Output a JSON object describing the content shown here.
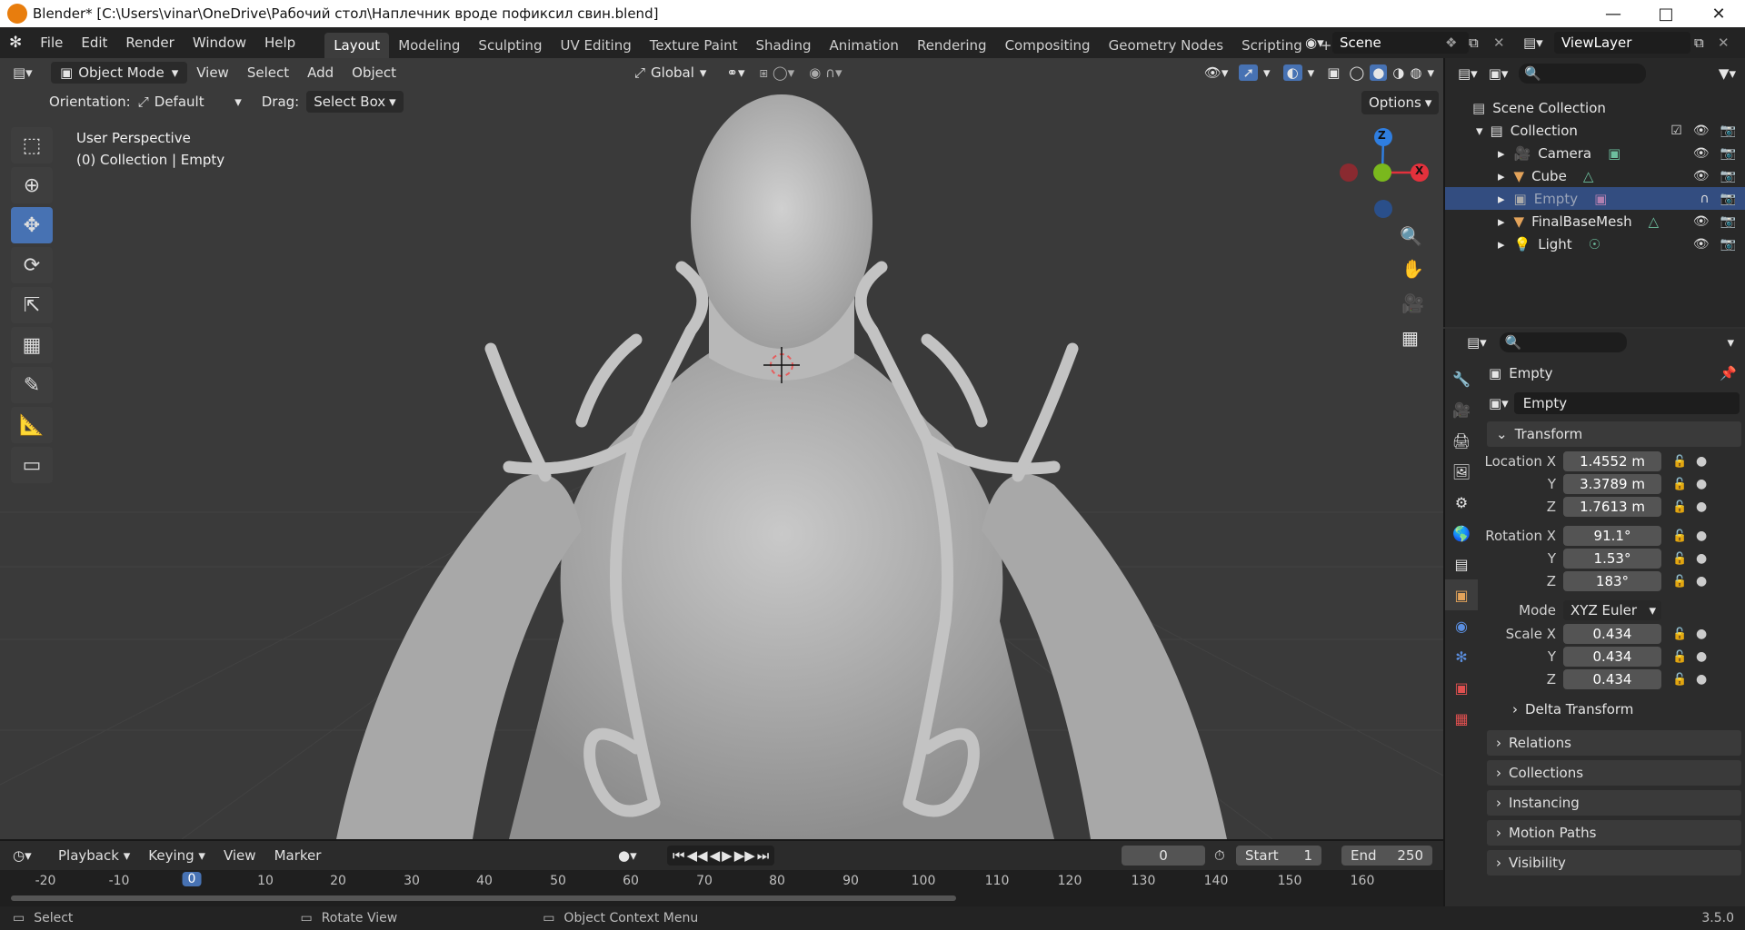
{
  "window": {
    "title": "Blender* [C:\\Users\\vinar\\OneDrive\\Рабочий стол\\Наплечник вроде пофиксил свин.blend]"
  },
  "menus": [
    "File",
    "Edit",
    "Render",
    "Window",
    "Help"
  ],
  "workspaces": [
    "Layout",
    "Modeling",
    "Sculpting",
    "UV Editing",
    "Texture Paint",
    "Shading",
    "Animation",
    "Rendering",
    "Compositing",
    "Geometry Nodes",
    "Scripting",
    "+"
  ],
  "active_workspace": "Layout",
  "scene": "Scene",
  "view_layer": "ViewLayer",
  "viewport_header": {
    "mode": "Object Mode",
    "menus": [
      "View",
      "Select",
      "Add",
      "Object"
    ],
    "transform_orientation": "Global",
    "orientation_label": "Orientation:",
    "orientation_value": "Default",
    "drag_label": "Drag:",
    "drag_value": "Select Box",
    "options": "Options"
  },
  "viewport": {
    "perspective": "User Perspective",
    "context": "(0) Collection | Empty",
    "gizmo_axes": [
      "Z",
      "X",
      "Y"
    ]
  },
  "outliner": {
    "root": "Scene Collection",
    "collection": "Collection",
    "items": [
      {
        "name": "Camera",
        "selected": false
      },
      {
        "name": "Cube",
        "selected": false
      },
      {
        "name": "Empty",
        "selected": true
      },
      {
        "name": "FinalBaseMesh",
        "selected": false
      },
      {
        "name": "Light",
        "selected": false
      }
    ]
  },
  "properties": {
    "object_name": "Empty",
    "datablock_name": "Empty",
    "transform_label": "Transform",
    "location_label": "Location X",
    "location": [
      "1.4552 m",
      "3.3789 m",
      "1.7613 m"
    ],
    "rotation_label": "Rotation X",
    "rotation": [
      "91.1°",
      "1.53°",
      "183°"
    ],
    "mode_label": "Mode",
    "mode": "XYZ Euler",
    "scale_label": "Scale X",
    "scale": [
      "0.434",
      "0.434",
      "0.434"
    ],
    "axis_y": "Y",
    "axis_z": "Z",
    "delta_transform": "Delta Transform",
    "panels": [
      "Relations",
      "Collections",
      "Instancing",
      "Motion Paths",
      "Visibility"
    ]
  },
  "timeline": {
    "menus": [
      "Playback",
      "Keying",
      "View",
      "Marker"
    ],
    "current_frame": "0",
    "start_label": "Start",
    "start": "1",
    "end_label": "End",
    "end": "250",
    "ticks": [
      "-20",
      "-10",
      "0",
      "10",
      "20",
      "30",
      "40",
      "50",
      "60",
      "70",
      "80",
      "90",
      "100",
      "110",
      "120",
      "130",
      "140",
      "150",
      "160"
    ]
  },
  "statusbar": {
    "select": "Select",
    "rotate": "Rotate View",
    "context_menu": "Object Context Menu",
    "version": "3.5.0"
  },
  "colors": {
    "accent": "#4772b3",
    "selected_row": "#334d80",
    "x_axis": "#e3313c",
    "y_axis": "#7ab81d",
    "z_axis": "#2f7ee0"
  }
}
